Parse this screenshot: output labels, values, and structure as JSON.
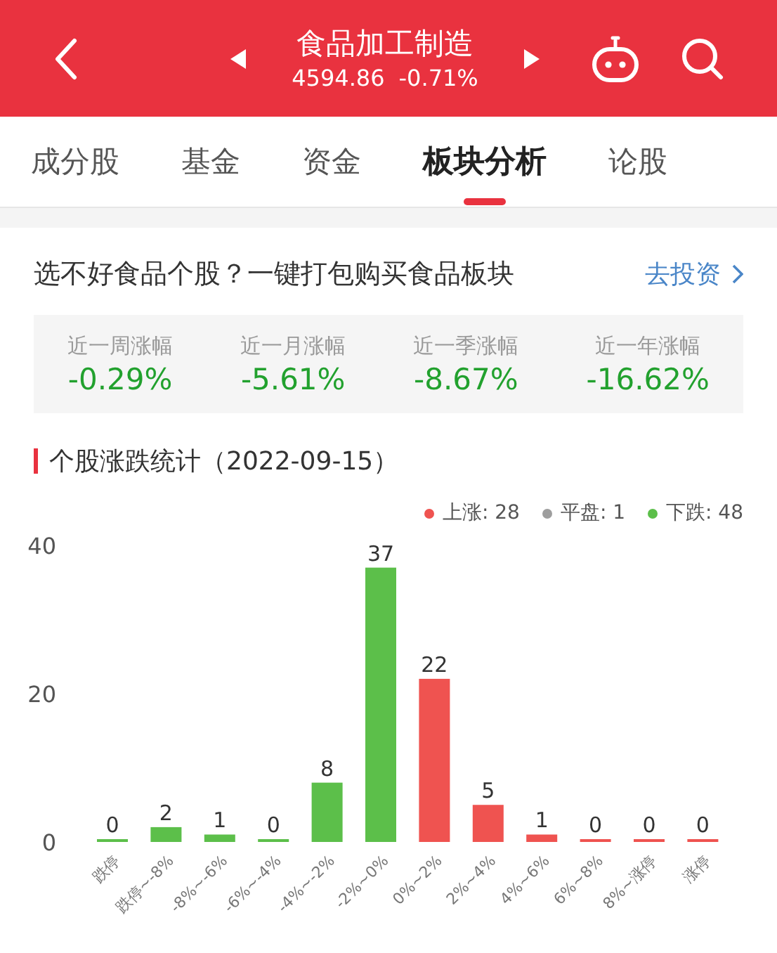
{
  "header": {
    "title": "食品加工制造",
    "price": "4594.86",
    "change": "-0.71%"
  },
  "tabs": [
    {
      "label": "成分股",
      "selected": false
    },
    {
      "label": "基金",
      "selected": false
    },
    {
      "label": "资金",
      "selected": false
    },
    {
      "label": "板块分析",
      "selected": true
    },
    {
      "label": "论股",
      "selected": false
    }
  ],
  "promo": {
    "text": "选不好食品个股？一键打包购买食品板块",
    "link": "去投资"
  },
  "stats": [
    {
      "label": "近一周涨幅",
      "value": "-0.29%"
    },
    {
      "label": "近一月涨幅",
      "value": "-5.61%"
    },
    {
      "label": "近一季涨幅",
      "value": "-8.67%"
    },
    {
      "label": "近一年涨幅",
      "value": "-16.62%"
    }
  ],
  "chart_section": {
    "title": "个股涨跌统计（2022-09-15）",
    "legend": [
      {
        "label": "上涨: 28",
        "color": "#ef5350"
      },
      {
        "label": "平盘: 1",
        "color": "#9e9e9e"
      },
      {
        "label": "下跌: 48",
        "color": "#5cbf4a"
      }
    ],
    "chart_data": {
      "type": "bar",
      "categories": [
        "跌停",
        "跌停~-8%",
        "-8%~-6%",
        "-6%~-4%",
        "-4%~-2%",
        "-2%~0%",
        "0%~2%",
        "2%~4%",
        "4%~6%",
        "6%~8%",
        "8%~涨停",
        "涨停"
      ],
      "series": [
        {
          "color": "#5cbf4a",
          "values": [
            0,
            2,
            1,
            0,
            8,
            37,
            null,
            null,
            null,
            null,
            null,
            null
          ]
        },
        {
          "color": "#ef5350",
          "values": [
            null,
            null,
            null,
            null,
            null,
            null,
            22,
            5,
            1,
            0,
            0,
            0
          ]
        }
      ],
      "ylim": [
        0,
        40
      ],
      "yticks": [
        0,
        20,
        40
      ],
      "data_labels": true
    }
  }
}
